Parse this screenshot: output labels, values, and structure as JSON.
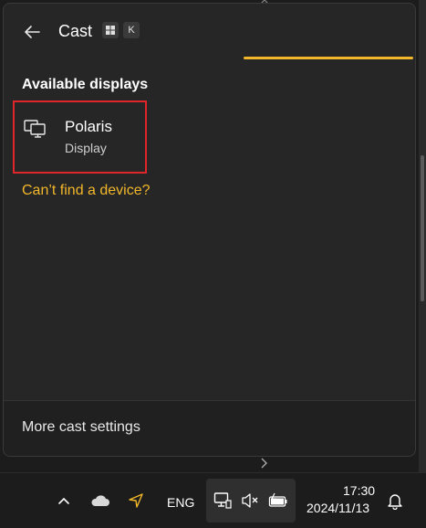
{
  "panel": {
    "title": "Cast",
    "shortcut_keys": [
      "⊞",
      "K"
    ],
    "section_heading": "Available displays",
    "devices": [
      {
        "name": "Polaris",
        "type": "Display",
        "icon": "cast-display-icon"
      }
    ],
    "help_link": "Can’t find a device?",
    "footer_link": "More cast settings",
    "progress_active": true
  },
  "taskbar": {
    "language": "ENG",
    "time": "17:30",
    "date": "2024/11/13",
    "icons": [
      "chevron-up-icon",
      "cloud-icon",
      "location-icon",
      "network-icon",
      "volume-muted-icon",
      "battery-icon",
      "bell-icon"
    ]
  },
  "colors": {
    "accent": "#f2b72a",
    "highlight_box": "#e0262b",
    "panel_bg": "#262626",
    "taskbar_bg": "#1c1c1c"
  }
}
